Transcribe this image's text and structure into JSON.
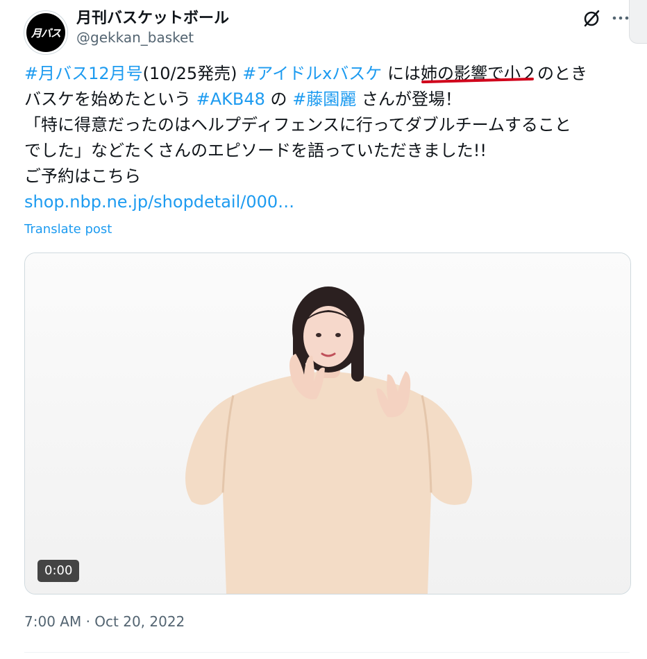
{
  "account": {
    "name": "月刊バスケットボール",
    "handle": "@gekkan_basket",
    "avatar_text": "月バス"
  },
  "icons": {
    "grok": "grok-slash-icon",
    "more": "more-dots-icon"
  },
  "post": {
    "line1": {
      "tag1": "#月バス12月号",
      "t1": "(10/25発売) ",
      "tag2": "#アイドルxバスケ",
      "t2": " には姉の影響で小２のとき"
    },
    "line2": {
      "t1": "バスケを始めたという ",
      "tag1": "#AKB48",
      "t2": " の ",
      "tag2": "#藤園麗",
      "t3": " さんが登場！"
    },
    "line3": "「特に得意だったのはヘルプディフェンスに行ってダブルチームすること",
    "line4": "でした」などたくさんのエピソードを語っていただきました!!",
    "line5": "ご予約はこちら",
    "link": "shop.nbp.ne.jp/shopdetail/000…"
  },
  "translate_label": "Translate post",
  "video": {
    "duration": "0:00"
  },
  "timestamp": "7:00 AM · Oct 20, 2022",
  "colors": {
    "accent": "#1d9bf0",
    "text": "#0f1419",
    "muted": "#536471",
    "annotation": "#d0021b"
  }
}
